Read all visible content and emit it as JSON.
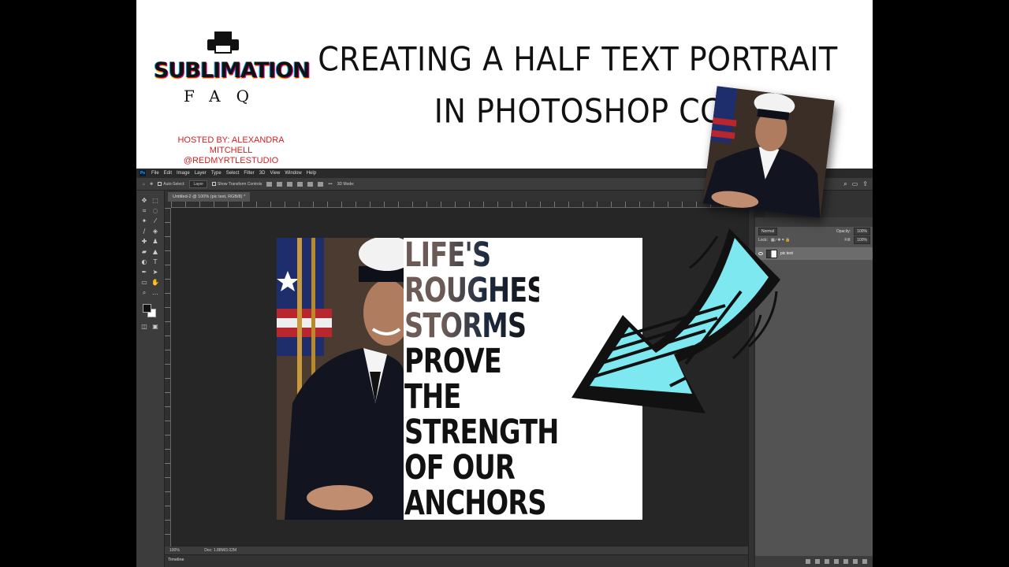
{
  "header": {
    "logo_main": "SUBLIMATION",
    "logo_sub": "FAQ",
    "host_line1": "HOSTED BY: ALEXANDRA MITCHELL",
    "host_line2": "@REDMYRTLESTUDIO",
    "title_line1": "CREATING A HALF TEXT PORTRAIT",
    "title_line2": "IN PHOTOSHOP CC"
  },
  "menubar": {
    "items": [
      "File",
      "Edit",
      "Image",
      "Layer",
      "Type",
      "Select",
      "Filter",
      "3D",
      "View",
      "Window",
      "Help"
    ]
  },
  "options_bar": {
    "auto_select": "Auto-Select:",
    "layer_select": "Layer",
    "transform_controls": "Show Transform Controls",
    "mode_3d": "3D Mode:"
  },
  "document": {
    "tab_title": "Untitled-2 @ 100% (pic text, RGB/8) *",
    "zoom": "100%",
    "doc_size": "Doc: 1.88M/3.02M",
    "timeline_label": "Timeline"
  },
  "layers_panel": {
    "blend_mode": "Normal",
    "opacity_label": "Opacity:",
    "opacity_value": "100%",
    "lock_label": "Lock:",
    "fill_label": "Fill:",
    "fill_value": "100%",
    "layer_name": "pic text"
  },
  "canvas_text": {
    "lines": [
      "LIFE'S",
      "ROUGHEST",
      "STORMS",
      "PROVE",
      "THE",
      "STRENGTH",
      "OF OUR",
      "ANCHORS"
    ]
  },
  "colors": {
    "arrow_fill": "#7de8ef",
    "host_red": "#d21f1f",
    "ps_dark": "#262626"
  }
}
